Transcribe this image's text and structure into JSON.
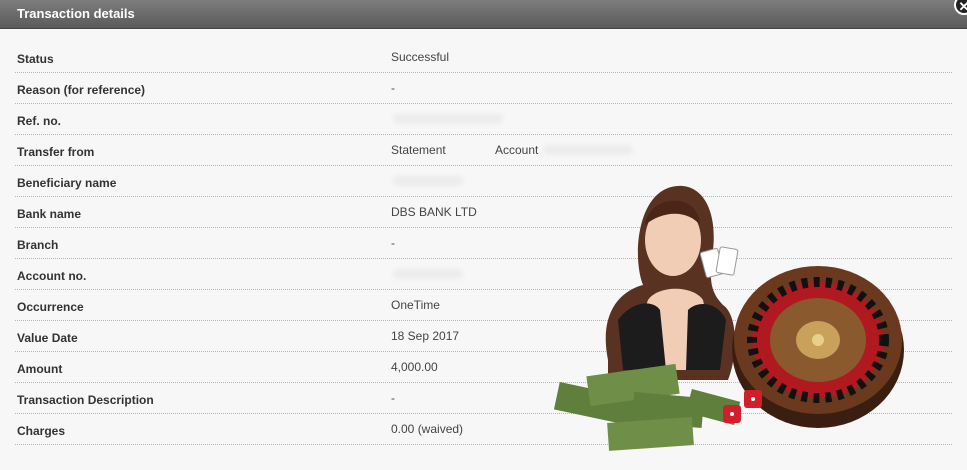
{
  "dialog": {
    "title": "Transaction details",
    "close_symbol": "✕"
  },
  "rows": [
    {
      "label": "Status",
      "value": "Successful"
    },
    {
      "label": "Reason (for reference)",
      "value": "-"
    },
    {
      "label": "Ref. no.",
      "value": ""
    },
    {
      "label": "Transfer from",
      "value": "Statement",
      "value2": "Account"
    },
    {
      "label": "Beneficiary name",
      "value": ""
    },
    {
      "label": "Bank name",
      "value": "DBS BANK LTD"
    },
    {
      "label": "Branch",
      "value": "-"
    },
    {
      "label": "Account no.",
      "value": ""
    },
    {
      "label": "Occurrence",
      "value": "OneTime"
    },
    {
      "label": "Value Date",
      "value": "18 Sep 2017"
    },
    {
      "label": "Amount",
      "value": "4,000.00"
    },
    {
      "label": "Transaction Description",
      "value": "-"
    },
    {
      "label": "Charges",
      "value": "0.00 (waived)"
    }
  ],
  "advert": {
    "icon": "casino-roulette-ad-icon",
    "colors": {
      "wheel_wood": "#6b3a1e",
      "wheel_red": "#b0191f",
      "cash_green": "#5f7f3c",
      "dice": "#d21e2b"
    }
  }
}
